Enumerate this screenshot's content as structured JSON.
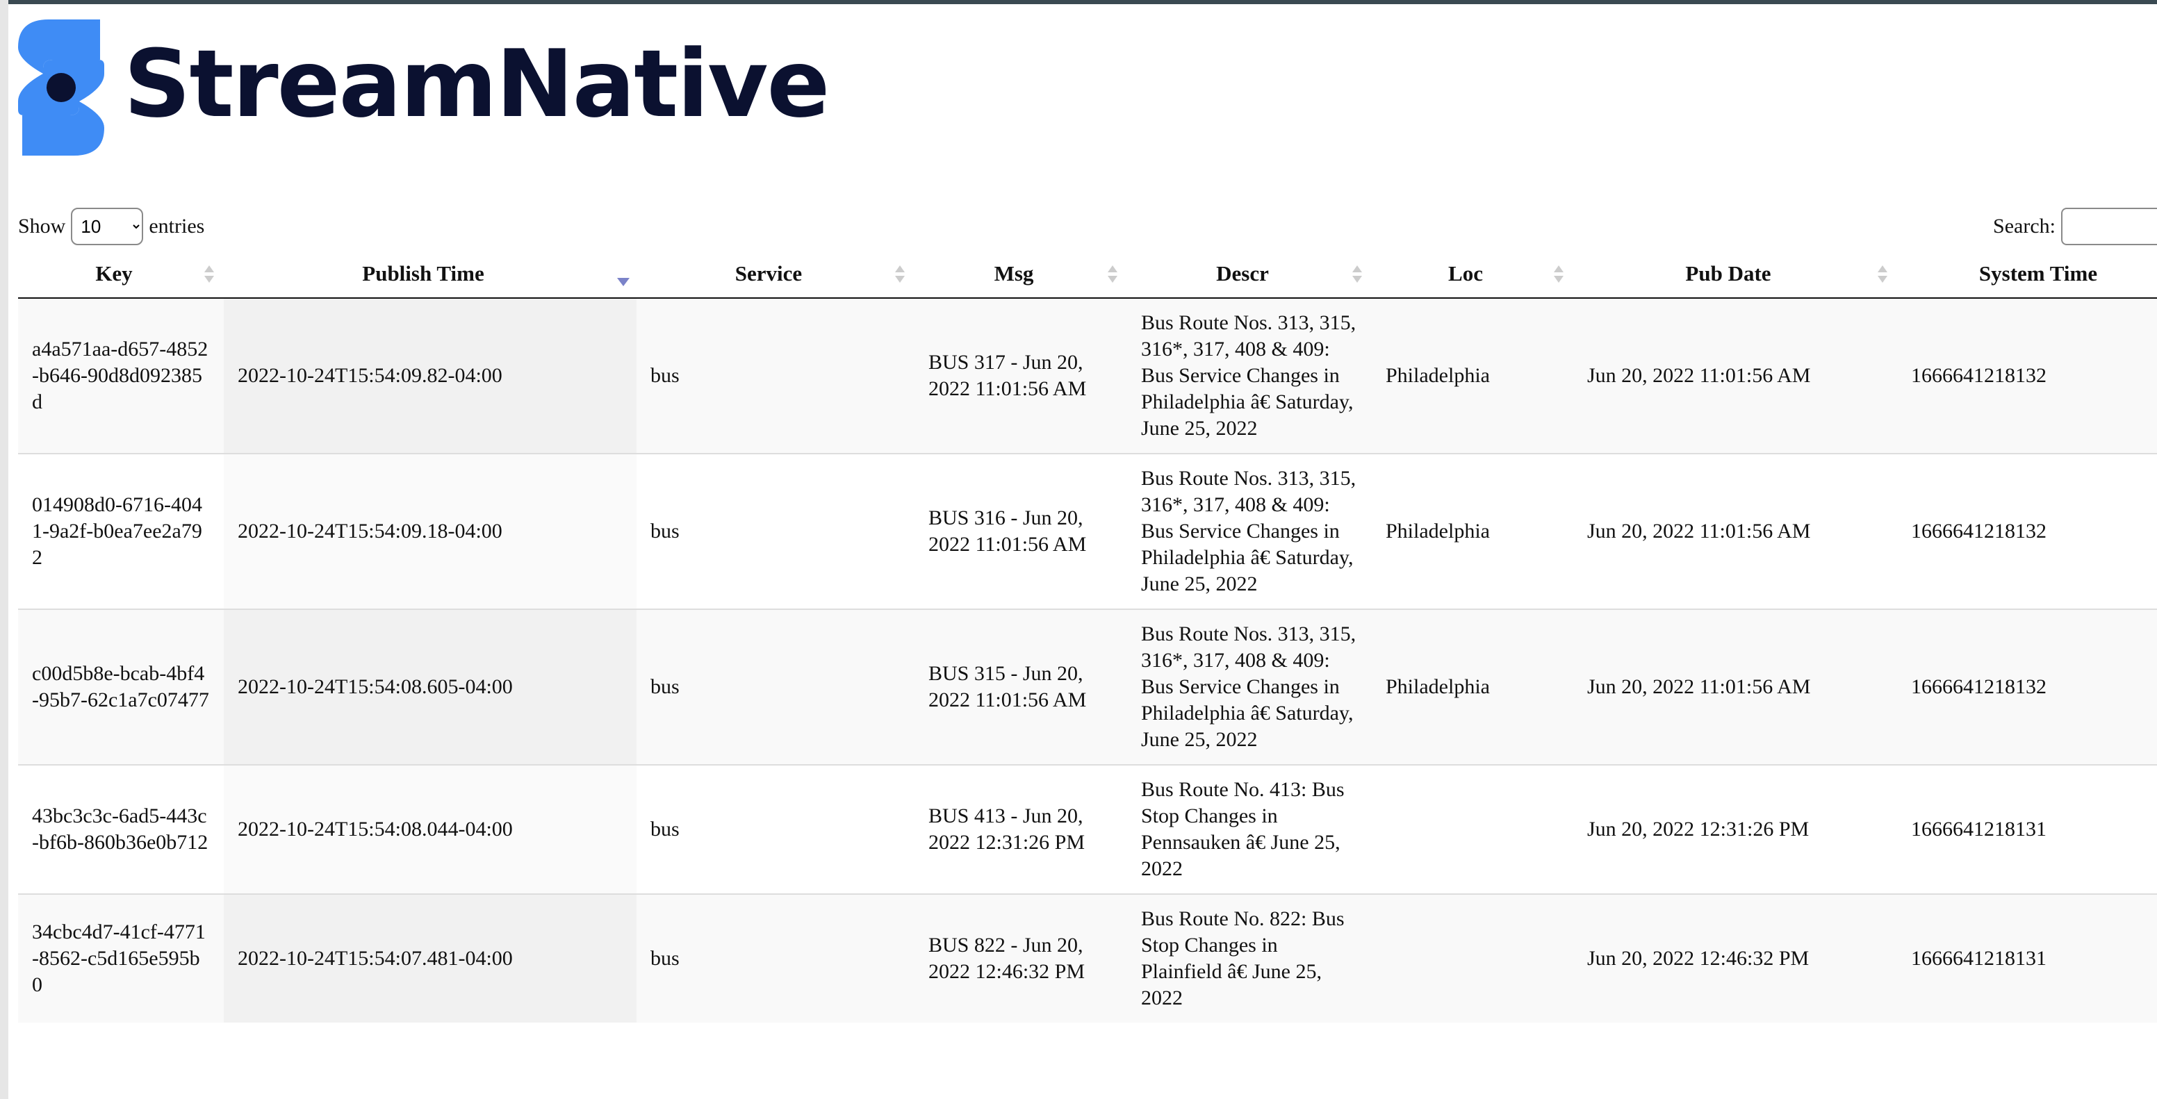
{
  "brand": {
    "name": "StreamNative",
    "mark_dot_color": "#0b1130",
    "mark_color": "#3f8cf5",
    "text_color": "#0b1130"
  },
  "controls": {
    "show_label": "Show",
    "entries_label": "entries",
    "page_length": "10",
    "page_length_options": [
      "10"
    ],
    "search_label": "Search:",
    "search_value": ""
  },
  "table": {
    "columns": [
      "Key",
      "Publish Time",
      "Service",
      "Msg",
      "Descr",
      "Loc",
      "Pub Date",
      "System Time"
    ],
    "sorted_column": "Publish Time",
    "sort_direction": "desc",
    "rows": [
      {
        "key": "a4a571aa-d657-4852-b646-90d8d092385d",
        "publish_time": "2022-10-24T15:54:09.82-04:00",
        "service": "bus",
        "msg": "BUS 317 - Jun 20, 2022 11:01:56 AM",
        "descr": "Bus Route Nos. 313, 315, 316*, 317, 408 & 409: Bus Service Changes in Philadelphia â€ Saturday, June 25, 2022",
        "loc": "Philadelphia",
        "pub_date": "Jun 20, 2022 11:01:56 AM",
        "system_time": "1666641218132"
      },
      {
        "key": "014908d0-6716-4041-9a2f-b0ea7ee2a792",
        "publish_time": "2022-10-24T15:54:09.18-04:00",
        "service": "bus",
        "msg": "BUS 316 - Jun 20, 2022 11:01:56 AM",
        "descr": "Bus Route Nos. 313, 315, 316*, 317, 408 & 409: Bus Service Changes in Philadelphia â€ Saturday, June 25, 2022",
        "loc": "Philadelphia",
        "pub_date": "Jun 20, 2022 11:01:56 AM",
        "system_time": "1666641218132"
      },
      {
        "key": "c00d5b8e-bcab-4bf4-95b7-62c1a7c07477",
        "publish_time": "2022-10-24T15:54:08.605-04:00",
        "service": "bus",
        "msg": "BUS 315 - Jun 20, 2022 11:01:56 AM",
        "descr": "Bus Route Nos. 313, 315, 316*, 317, 408 & 409: Bus Service Changes in Philadelphia â€ Saturday, June 25, 2022",
        "loc": "Philadelphia",
        "pub_date": "Jun 20, 2022 11:01:56 AM",
        "system_time": "1666641218132"
      },
      {
        "key": "43bc3c3c-6ad5-443c-bf6b-860b36e0b712",
        "publish_time": "2022-10-24T15:54:08.044-04:00",
        "service": "bus",
        "msg": "BUS 413 - Jun 20, 2022 12:31:26 PM",
        "descr": "Bus Route No. 413: Bus Stop Changes in Pennsauken â€     June 25, 2022",
        "loc": "",
        "pub_date": "Jun 20, 2022 12:31:26 PM",
        "system_time": "1666641218131"
      },
      {
        "key": "34cbc4d7-41cf-4771-8562-c5d165e595b0",
        "publish_time": "2022-10-24T15:54:07.481-04:00",
        "service": "bus",
        "msg": "BUS 822 - Jun 20, 2022 12:46:32 PM",
        "descr": "Bus Route No. 822: Bus Stop Changes in Plainfield â€     June 25, 2022",
        "loc": "",
        "pub_date": "Jun 20, 2022 12:46:32 PM",
        "system_time": "1666641218131"
      }
    ]
  }
}
